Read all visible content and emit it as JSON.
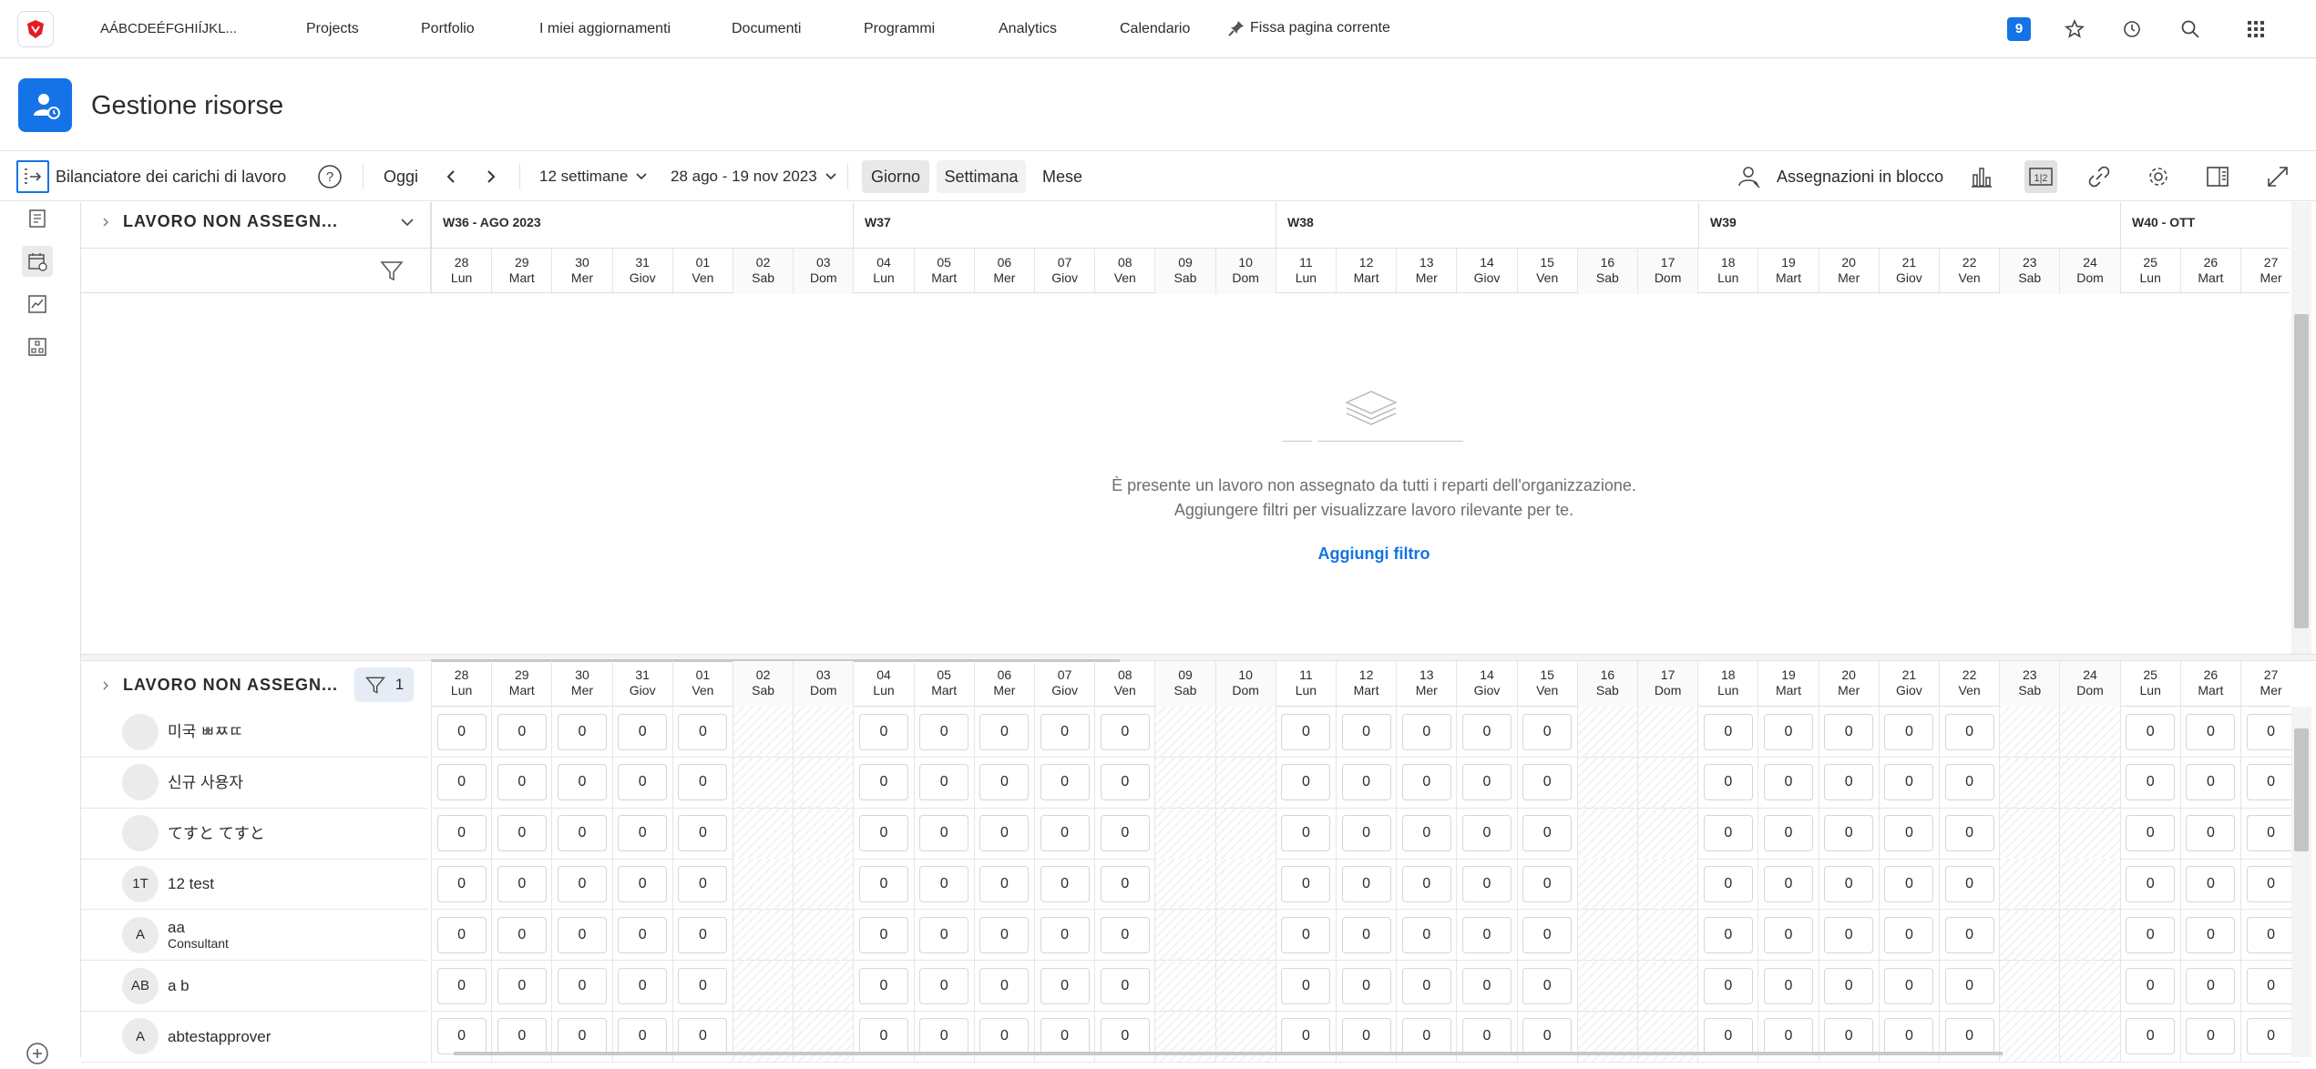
{
  "nav": {
    "org": "AÁBCDEÉFGHIÍJKL...",
    "items": [
      "Projects",
      "Portfolio",
      "I miei aggiornamenti",
      "Documenti",
      "Programmi",
      "Analytics",
      "Calendario"
    ],
    "pin_label": "Fissa pagina corrente",
    "notifications": "9"
  },
  "page": {
    "title": "Gestione risorse"
  },
  "toolbar": {
    "title": "Bilanciatore dei carichi di lavoro",
    "today": "Oggi",
    "span": "12 settimane",
    "range": "28 ago - 19 nov 2023",
    "views": [
      "Giorno",
      "Settimana",
      "Mese"
    ],
    "active_view": "Giorno",
    "bulk": "Assegnazioni in blocco"
  },
  "unassigned": {
    "heading": "LAVORO NON ASSEGN...",
    "empty_line1": "È presente un lavoro non assegnato da tutti i reparti dell'organizzazione.",
    "empty_line2": "Aggiungere filtri per visualizzare lavoro rilevante per te.",
    "add_filter": "Aggiungi filtro"
  },
  "assigned": {
    "heading": "LAVORO NON ASSEGN...",
    "filter_count": "1"
  },
  "weeks": [
    "W36 - AGO 2023",
    "W37",
    "W38",
    "W39",
    "W40 - OTT"
  ],
  "days": [
    {
      "n": "28",
      "d": "Lun"
    },
    {
      "n": "29",
      "d": "Mart"
    },
    {
      "n": "30",
      "d": "Mer"
    },
    {
      "n": "31",
      "d": "Giov"
    },
    {
      "n": "01",
      "d": "Ven"
    },
    {
      "n": "02",
      "d": "Sab"
    },
    {
      "n": "03",
      "d": "Dom"
    },
    {
      "n": "04",
      "d": "Lun"
    },
    {
      "n": "05",
      "d": "Mart"
    },
    {
      "n": "06",
      "d": "Mer"
    },
    {
      "n": "07",
      "d": "Giov"
    },
    {
      "n": "08",
      "d": "Ven"
    },
    {
      "n": "09",
      "d": "Sab"
    },
    {
      "n": "10",
      "d": "Dom"
    },
    {
      "n": "11",
      "d": "Lun"
    },
    {
      "n": "12",
      "d": "Mart"
    },
    {
      "n": "13",
      "d": "Mer"
    },
    {
      "n": "14",
      "d": "Giov"
    },
    {
      "n": "15",
      "d": "Ven"
    },
    {
      "n": "16",
      "d": "Sab"
    },
    {
      "n": "17",
      "d": "Dom"
    },
    {
      "n": "18",
      "d": "Lun"
    },
    {
      "n": "19",
      "d": "Mart"
    },
    {
      "n": "20",
      "d": "Mer"
    },
    {
      "n": "21",
      "d": "Giov"
    },
    {
      "n": "22",
      "d": "Ven"
    },
    {
      "n": "23",
      "d": "Sab"
    },
    {
      "n": "24",
      "d": "Dom"
    },
    {
      "n": "25",
      "d": "Lun"
    },
    {
      "n": "26",
      "d": "Mart"
    },
    {
      "n": "27",
      "d": "Mer"
    }
  ],
  "users": [
    {
      "initials": "",
      "name": "미국 ㅃㅉㄸ",
      "role": ""
    },
    {
      "initials": "",
      "name": "신규 사용자",
      "role": ""
    },
    {
      "initials": "",
      "name": "てすと てすと",
      "role": ""
    },
    {
      "initials": "1T",
      "name": "12 test",
      "role": ""
    },
    {
      "initials": "A",
      "name": "aa",
      "role": "Consultant"
    },
    {
      "initials": "AB",
      "name": "a b",
      "role": ""
    },
    {
      "initials": "A",
      "name": "abtestapprover",
      "role": ""
    }
  ],
  "cell_value": "0"
}
